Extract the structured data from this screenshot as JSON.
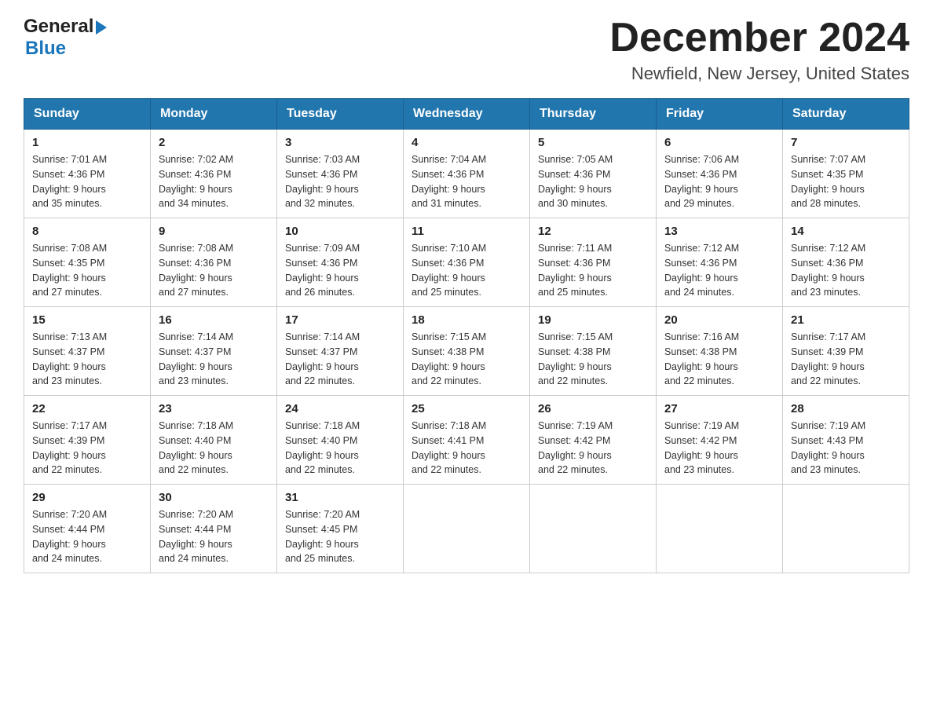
{
  "header": {
    "logo_line1": "General",
    "logo_line2": "Blue",
    "month_title": "December 2024",
    "location": "Newfield, New Jersey, United States"
  },
  "days_of_week": [
    "Sunday",
    "Monday",
    "Tuesday",
    "Wednesday",
    "Thursday",
    "Friday",
    "Saturday"
  ],
  "weeks": [
    [
      {
        "day": "1",
        "sunrise": "7:01 AM",
        "sunset": "4:36 PM",
        "daylight": "9 hours and 35 minutes."
      },
      {
        "day": "2",
        "sunrise": "7:02 AM",
        "sunset": "4:36 PM",
        "daylight": "9 hours and 34 minutes."
      },
      {
        "day": "3",
        "sunrise": "7:03 AM",
        "sunset": "4:36 PM",
        "daylight": "9 hours and 32 minutes."
      },
      {
        "day": "4",
        "sunrise": "7:04 AM",
        "sunset": "4:36 PM",
        "daylight": "9 hours and 31 minutes."
      },
      {
        "day": "5",
        "sunrise": "7:05 AM",
        "sunset": "4:36 PM",
        "daylight": "9 hours and 30 minutes."
      },
      {
        "day": "6",
        "sunrise": "7:06 AM",
        "sunset": "4:36 PM",
        "daylight": "9 hours and 29 minutes."
      },
      {
        "day": "7",
        "sunrise": "7:07 AM",
        "sunset": "4:35 PM",
        "daylight": "9 hours and 28 minutes."
      }
    ],
    [
      {
        "day": "8",
        "sunrise": "7:08 AM",
        "sunset": "4:35 PM",
        "daylight": "9 hours and 27 minutes."
      },
      {
        "day": "9",
        "sunrise": "7:08 AM",
        "sunset": "4:36 PM",
        "daylight": "9 hours and 27 minutes."
      },
      {
        "day": "10",
        "sunrise": "7:09 AM",
        "sunset": "4:36 PM",
        "daylight": "9 hours and 26 minutes."
      },
      {
        "day": "11",
        "sunrise": "7:10 AM",
        "sunset": "4:36 PM",
        "daylight": "9 hours and 25 minutes."
      },
      {
        "day": "12",
        "sunrise": "7:11 AM",
        "sunset": "4:36 PM",
        "daylight": "9 hours and 25 minutes."
      },
      {
        "day": "13",
        "sunrise": "7:12 AM",
        "sunset": "4:36 PM",
        "daylight": "9 hours and 24 minutes."
      },
      {
        "day": "14",
        "sunrise": "7:12 AM",
        "sunset": "4:36 PM",
        "daylight": "9 hours and 23 minutes."
      }
    ],
    [
      {
        "day": "15",
        "sunrise": "7:13 AM",
        "sunset": "4:37 PM",
        "daylight": "9 hours and 23 minutes."
      },
      {
        "day": "16",
        "sunrise": "7:14 AM",
        "sunset": "4:37 PM",
        "daylight": "9 hours and 23 minutes."
      },
      {
        "day": "17",
        "sunrise": "7:14 AM",
        "sunset": "4:37 PM",
        "daylight": "9 hours and 22 minutes."
      },
      {
        "day": "18",
        "sunrise": "7:15 AM",
        "sunset": "4:38 PM",
        "daylight": "9 hours and 22 minutes."
      },
      {
        "day": "19",
        "sunrise": "7:15 AM",
        "sunset": "4:38 PM",
        "daylight": "9 hours and 22 minutes."
      },
      {
        "day": "20",
        "sunrise": "7:16 AM",
        "sunset": "4:38 PM",
        "daylight": "9 hours and 22 minutes."
      },
      {
        "day": "21",
        "sunrise": "7:17 AM",
        "sunset": "4:39 PM",
        "daylight": "9 hours and 22 minutes."
      }
    ],
    [
      {
        "day": "22",
        "sunrise": "7:17 AM",
        "sunset": "4:39 PM",
        "daylight": "9 hours and 22 minutes."
      },
      {
        "day": "23",
        "sunrise": "7:18 AM",
        "sunset": "4:40 PM",
        "daylight": "9 hours and 22 minutes."
      },
      {
        "day": "24",
        "sunrise": "7:18 AM",
        "sunset": "4:40 PM",
        "daylight": "9 hours and 22 minutes."
      },
      {
        "day": "25",
        "sunrise": "7:18 AM",
        "sunset": "4:41 PM",
        "daylight": "9 hours and 22 minutes."
      },
      {
        "day": "26",
        "sunrise": "7:19 AM",
        "sunset": "4:42 PM",
        "daylight": "9 hours and 22 minutes."
      },
      {
        "day": "27",
        "sunrise": "7:19 AM",
        "sunset": "4:42 PM",
        "daylight": "9 hours and 23 minutes."
      },
      {
        "day": "28",
        "sunrise": "7:19 AM",
        "sunset": "4:43 PM",
        "daylight": "9 hours and 23 minutes."
      }
    ],
    [
      {
        "day": "29",
        "sunrise": "7:20 AM",
        "sunset": "4:44 PM",
        "daylight": "9 hours and 24 minutes."
      },
      {
        "day": "30",
        "sunrise": "7:20 AM",
        "sunset": "4:44 PM",
        "daylight": "9 hours and 24 minutes."
      },
      {
        "day": "31",
        "sunrise": "7:20 AM",
        "sunset": "4:45 PM",
        "daylight": "9 hours and 25 minutes."
      },
      null,
      null,
      null,
      null
    ]
  ],
  "labels": {
    "sunrise": "Sunrise:",
    "sunset": "Sunset:",
    "daylight": "Daylight:"
  }
}
